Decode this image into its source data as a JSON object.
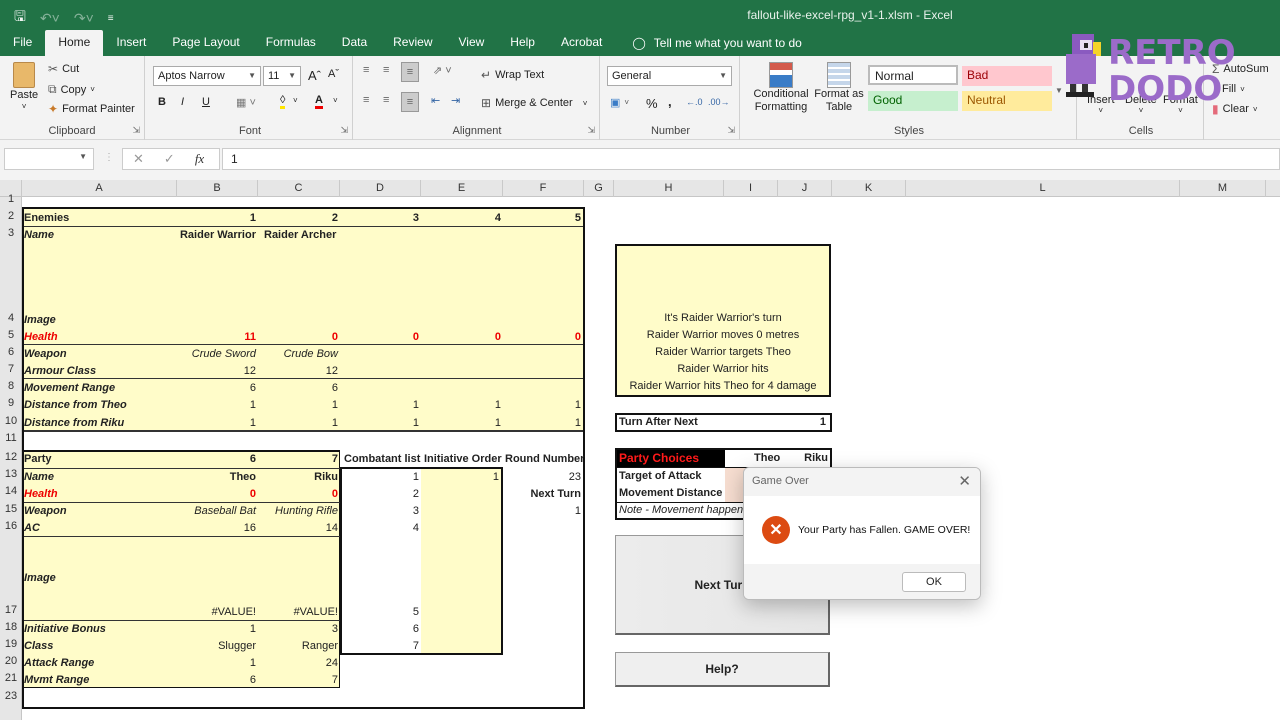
{
  "window": {
    "title": "fallout-like-excel-rpg_v1-1.xlsm  -  Excel"
  },
  "qat": {
    "save": "save-icon",
    "undo": "undo-icon",
    "redo": "redo-icon",
    "customize": "customize-icon"
  },
  "tabs": [
    "File",
    "Home",
    "Insert",
    "Page Layout",
    "Formulas",
    "Data",
    "Review",
    "View",
    "Help",
    "Acrobat"
  ],
  "tell_me": "Tell me what you want to do",
  "ribbon": {
    "clipboard": {
      "paste": "Paste",
      "cut": "Cut",
      "copy": "Copy",
      "format_painter": "Format Painter",
      "label": "Clipboard"
    },
    "font": {
      "name": "Aptos Narrow",
      "size": "11",
      "label": "Font",
      "bold": "B",
      "italic": "I",
      "underline": "U"
    },
    "alignment": {
      "wrap": "Wrap Text",
      "merge": "Merge & Center",
      "label": "Alignment"
    },
    "number": {
      "format": "General",
      "percent": "%",
      "comma": ",",
      "label": "Number"
    },
    "styles": {
      "conditional": "Conditional Formatting",
      "format_table": "Format as Table",
      "normal": "Normal",
      "bad": "Bad",
      "good": "Good",
      "neutral": "Neutral",
      "label": "Styles"
    },
    "cells": {
      "insert": "Insert",
      "delete": "Delete",
      "format": "Format",
      "label": "Cells"
    },
    "editing": {
      "autosum": "AutoSum",
      "fill": "Fill",
      "clear": "Clear"
    }
  },
  "formula_bar": {
    "name_box": "",
    "formula": "1"
  },
  "columns": [
    "A",
    "B",
    "C",
    "D",
    "E",
    "F",
    "G",
    "H",
    "I",
    "J",
    "K",
    "L",
    "M"
  ],
  "rows": [
    "1",
    "2",
    "3",
    "4",
    "5",
    "6",
    "7",
    "8",
    "9",
    "10",
    "11",
    "12",
    "13",
    "14",
    "15",
    "16",
    "17",
    "18",
    "19",
    "20",
    "21",
    "23"
  ],
  "enemies": {
    "header": "Enemies",
    "ids": [
      "1",
      "2",
      "3",
      "4",
      "5"
    ],
    "name_label": "Name",
    "names": [
      "Raider Warrior",
      "Raider Archer"
    ],
    "image_label": "Image",
    "health_label": "Health",
    "health": [
      "11",
      "0",
      "0",
      "0",
      "0"
    ],
    "weapon_label": "Weapon",
    "weapons": [
      "Crude Sword",
      "Crude Bow"
    ],
    "armour_label": "Armour Class",
    "armour": [
      "12",
      "12"
    ],
    "movement_label": "Movement Range",
    "movement": [
      "6",
      "6"
    ],
    "dist_theo_label": "Distance from Theo",
    "dist_theo": [
      "1",
      "1",
      "1",
      "1",
      "1"
    ],
    "dist_riku_label": "Distance from Riku",
    "dist_riku": [
      "1",
      "1",
      "1",
      "1",
      "1"
    ]
  },
  "party": {
    "header": "Party",
    "ids": [
      "6",
      "7"
    ],
    "name_label": "Name",
    "names": [
      "Theo",
      "Riku"
    ],
    "health_label": "Health",
    "health": [
      "0",
      "0"
    ],
    "weapon_label": "Weapon",
    "weapons": [
      "Baseball Bat",
      "Hunting Rifle"
    ],
    "ac_label": "AC",
    "ac": [
      "16",
      "14"
    ],
    "image_label": "Image",
    "image_vals": [
      "#VALUE!",
      "#VALUE!"
    ],
    "init_label": "Initiative Bonus",
    "init": [
      "1",
      "3"
    ],
    "class_label": "Class",
    "classes": [
      "Slugger",
      "Ranger"
    ],
    "attack_label": "Attack Range",
    "attack": [
      "1",
      "24"
    ],
    "mvmt_label": "Mvmt Range",
    "mvmt": [
      "6",
      "7"
    ]
  },
  "combat": {
    "combatant_label": "Combatant list",
    "initiative_label": "Initiative Order",
    "round_label": "Round Number",
    "combatants": [
      "1",
      "2",
      "3",
      "4",
      "5",
      "6",
      "7"
    ],
    "initiative_first": "1",
    "round_number": "23",
    "next_turn_label": "Next Turn",
    "next_turn": "1"
  },
  "log": [
    "It's Raider Warrior's turn",
    "Raider Warrior moves 0 metres",
    "Raider Warrior targets Theo",
    "Raider Warrior hits",
    "Raider Warrior hits Theo for 4 damage"
  ],
  "turn_after_next": {
    "label": "Turn After Next",
    "value": "1"
  },
  "party_choices": {
    "header": "Party Choices",
    "cols": [
      "Theo",
      "Riku"
    ],
    "target": "Target of Attack",
    "movement": "Movement Distance",
    "note": "Note - Movement happen"
  },
  "buttons": {
    "next_turn": "Next Turn",
    "help": "Help?"
  },
  "dialog": {
    "title": "Game Over",
    "message": "Your Party has Fallen. GAME OVER!",
    "ok": "OK"
  },
  "watermark": {
    "line1": "RETRO",
    "line2": "DODO"
  },
  "colors": {
    "excel_green": "#217346",
    "cell_yellow": "#fffcc9",
    "health_red": "#e00000",
    "error_orange": "#dc4b12",
    "watermark_purple": "#9b6bc9"
  }
}
